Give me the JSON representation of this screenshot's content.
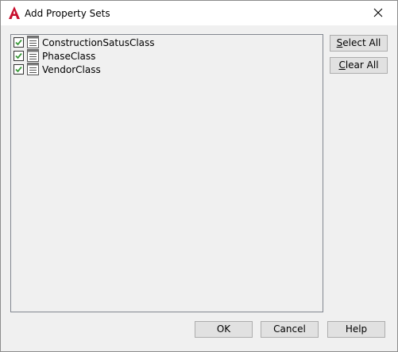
{
  "window": {
    "title": "Add Property Sets",
    "app_icon": "autocad-logo-icon",
    "close_icon": "close-icon"
  },
  "property_sets": [
    {
      "label": "ConstructionSatusClass",
      "checked": true,
      "icon": "document-list-icon"
    },
    {
      "label": "PhaseClass",
      "checked": true,
      "icon": "document-list-icon"
    },
    {
      "label": "VendorClass",
      "checked": true,
      "icon": "document-list-icon"
    }
  ],
  "side_buttons": {
    "select_all_mnemonic": "S",
    "select_all_rest": "elect All",
    "clear_all_mnemonic": "C",
    "clear_all_rest": "lear All"
  },
  "footer_buttons": {
    "ok": "OK",
    "cancel": "Cancel",
    "help": "Help"
  },
  "colors": {
    "accent_red": "#c8102e",
    "check_green": "#3a9a3a"
  }
}
